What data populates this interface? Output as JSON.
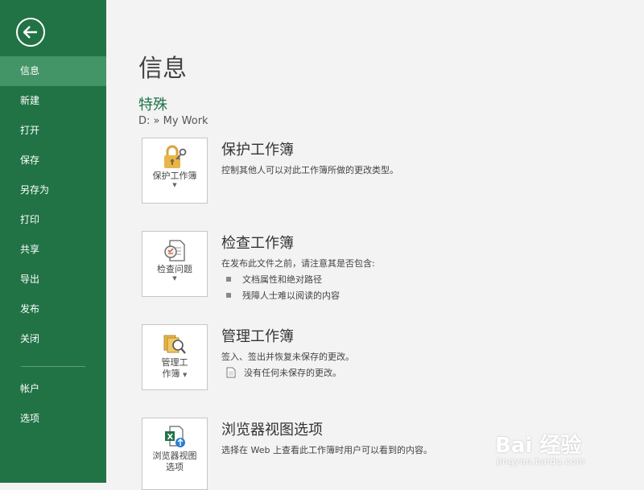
{
  "sidebar": {
    "back_icon": "back-arrow-icon",
    "items": [
      {
        "label": "信息",
        "selected": true
      },
      {
        "label": "新建"
      },
      {
        "label": "打开"
      },
      {
        "label": "保存"
      },
      {
        "label": "另存为"
      },
      {
        "label": "打印"
      },
      {
        "label": "共享"
      },
      {
        "label": "导出"
      },
      {
        "label": "发布"
      },
      {
        "label": "关闭"
      }
    ],
    "bottom_items": [
      {
        "label": "帐户"
      },
      {
        "label": "选项"
      }
    ],
    "color": "#217346",
    "selected_color": "#439467"
  },
  "main": {
    "title": "信息",
    "workbook_name": "特殊",
    "path": "D: » My Work",
    "sections": [
      {
        "tile_label_1": "保护工作簿",
        "tile_label_2": "",
        "icon": "lock-key-icon",
        "title": "保护工作簿",
        "description": "控制其他人可以对此工作簿所做的更改类型。"
      },
      {
        "tile_label_1": "检查问题",
        "tile_label_2": "",
        "icon": "inspect-document-icon",
        "title": "检查工作簿",
        "description": "在发布此文件之前，请注意其是否包含:",
        "bullets": [
          "文档属性和绝对路径",
          "残障人士难以阅读的内容"
        ]
      },
      {
        "tile_label_1": "管理工",
        "tile_label_2": "作簿",
        "icon": "manage-versions-icon",
        "title": "管理工作簿",
        "description": "签入、签出并恢复未保存的更改。",
        "bullets": [
          "没有任何未保存的更改。"
        ]
      },
      {
        "tile_label_1": "浏览器视图",
        "tile_label_2": "选项",
        "icon": "browser-view-icon",
        "title": "浏览器视图选项",
        "description": "选择在 Web 上查看此工作簿时用户可以看到的内容。"
      }
    ]
  },
  "watermark": {
    "main": "Bai 经验",
    "sub": "jingyan.baidu.com"
  }
}
